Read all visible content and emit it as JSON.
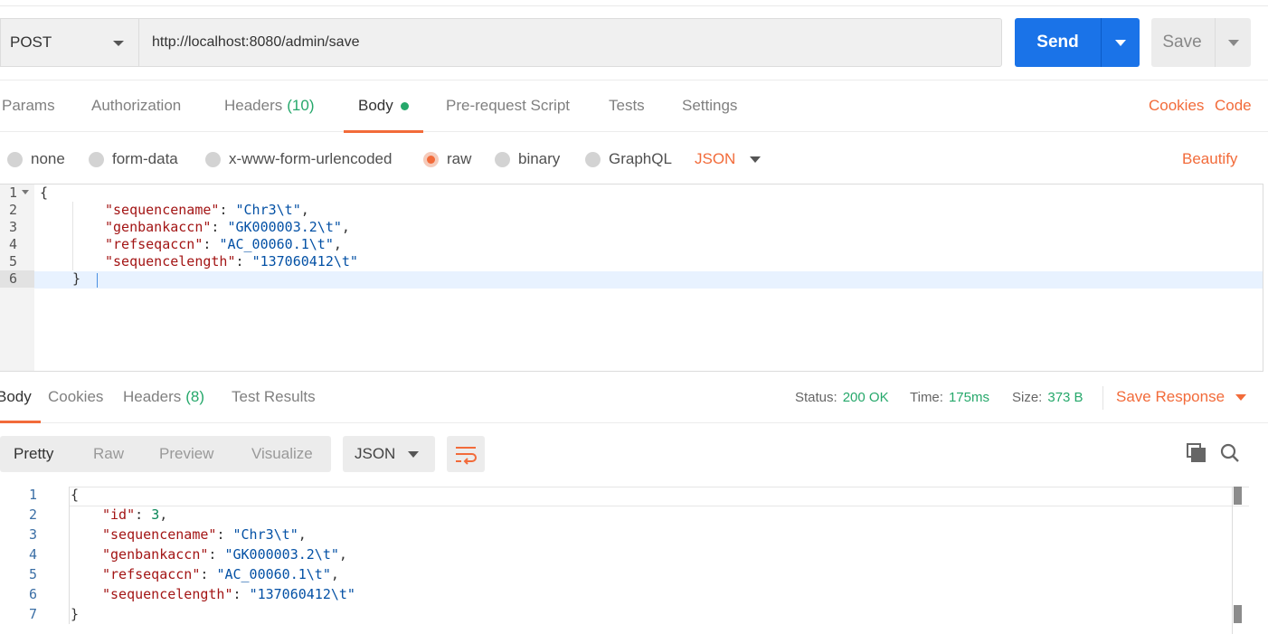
{
  "request": {
    "method": "POST",
    "url": "http://localhost:8080/admin/save",
    "send_label": "Send",
    "save_label": "Save"
  },
  "req_tabs": {
    "params": "Params",
    "authorization": "Authorization",
    "headers": "Headers",
    "headers_count": "(10)",
    "body": "Body",
    "prerequest": "Pre-request Script",
    "tests": "Tests",
    "settings": "Settings",
    "cookies": "Cookies",
    "code": "Code"
  },
  "body_types": {
    "none": "none",
    "form_data": "form-data",
    "urlencoded": "x-www-form-urlencoded",
    "raw": "raw",
    "binary": "binary",
    "graphql": "GraphQL",
    "selected": "raw",
    "format": "JSON",
    "beautify": "Beautify"
  },
  "request_body": {
    "line_numbers": [
      "1",
      "2",
      "3",
      "4",
      "5",
      "6"
    ],
    "open_brace": "{",
    "close_brace": "}",
    "fields": [
      {
        "key": "\"sequencename\"",
        "value": "\"Chr3\\t\"",
        "comma": ","
      },
      {
        "key": "\"genbankaccn\"",
        "value": "\"GK000003.2\\t\"",
        "comma": ","
      },
      {
        "key": "\"refseqaccn\"",
        "value": "\"AC_00060.1\\t\"",
        "comma": ","
      },
      {
        "key": "\"sequencelength\"",
        "value": "\"137060412\\t\"",
        "comma": ""
      }
    ]
  },
  "response_tabs": {
    "body": "Body",
    "cookies": "Cookies",
    "headers": "Headers",
    "headers_count": "(8)",
    "test_results": "Test Results"
  },
  "response_status": {
    "status_label": "Status:",
    "status_value": "200 OK",
    "time_label": "Time:",
    "time_value": "175ms",
    "size_label": "Size:",
    "size_value": "373 B",
    "save_response": "Save Response"
  },
  "response_view": {
    "pretty": "Pretty",
    "raw": "Raw",
    "preview": "Preview",
    "visualize": "Visualize",
    "format": "JSON"
  },
  "response_body": {
    "line_numbers": [
      "1",
      "2",
      "3",
      "4",
      "5",
      "6",
      "7"
    ],
    "open_brace": "{",
    "close_brace": "}",
    "fields": [
      {
        "key": "\"id\"",
        "value": "3",
        "comma": ","
      },
      {
        "key": "\"sequencename\"",
        "value": "\"Chr3\\t\"",
        "comma": ","
      },
      {
        "key": "\"genbankaccn\"",
        "value": "\"GK000003.2\\t\"",
        "comma": ","
      },
      {
        "key": "\"refseqaccn\"",
        "value": "\"AC_00060.1\\t\"",
        "comma": ","
      },
      {
        "key": "\"sequencelength\"",
        "value": "\"137060412\\t\"",
        "comma": ""
      }
    ]
  },
  "colors": {
    "accent_orange": "#f26b3a",
    "send_blue": "#1a73e8",
    "success_green": "#26a86b"
  }
}
